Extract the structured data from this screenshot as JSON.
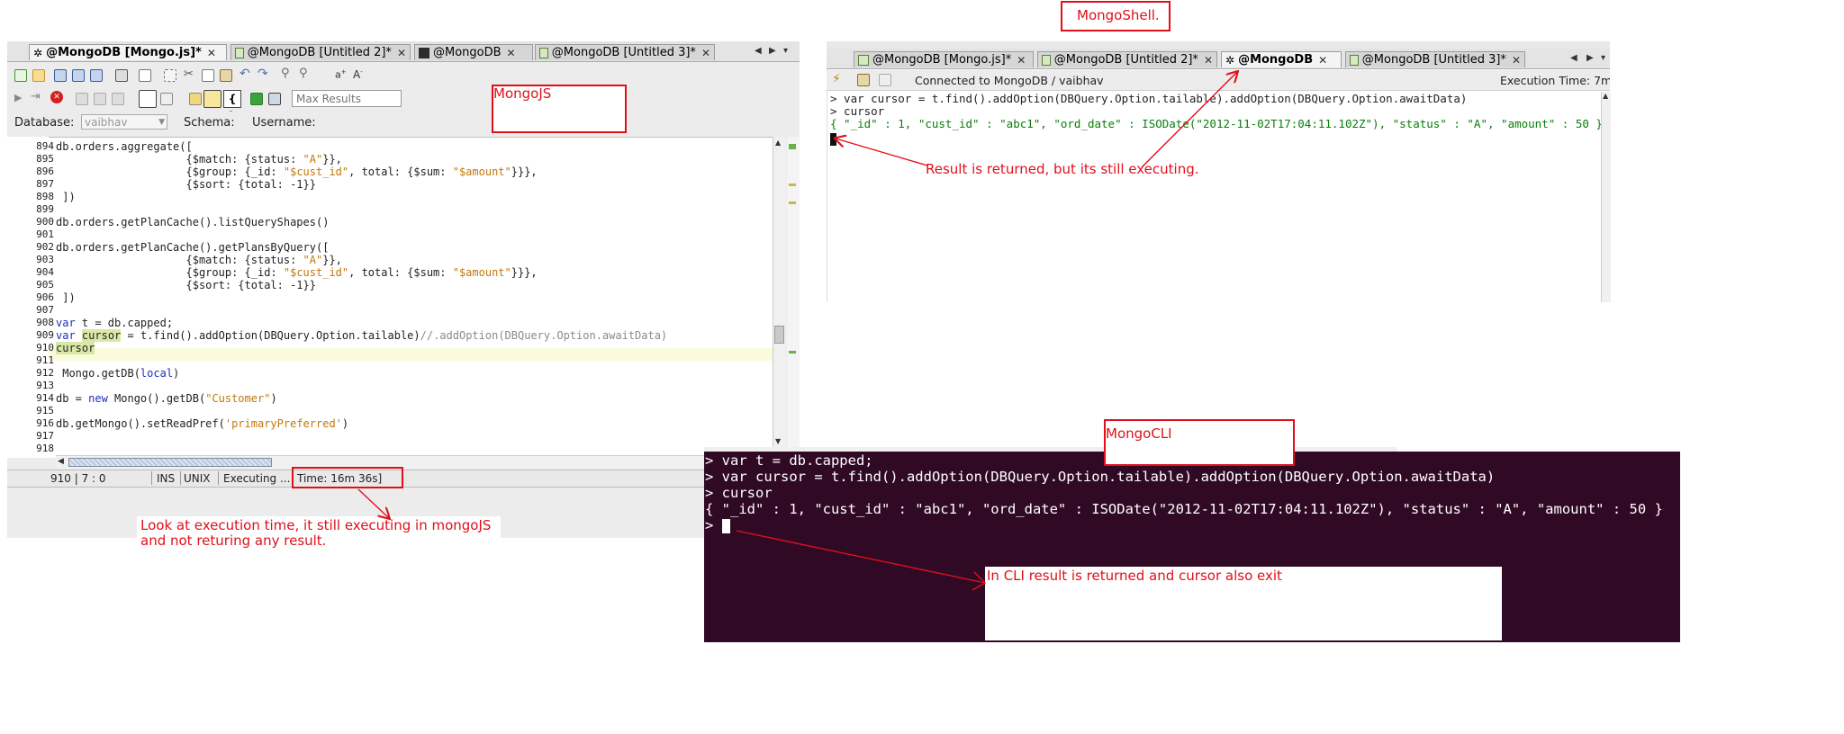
{
  "mongojs": {
    "tabs": [
      {
        "label": "@MongoDB [Mongo.js]*",
        "active": true
      },
      {
        "label": "@MongoDB [Untitled 2]*",
        "active": false
      },
      {
        "label": "@MongoDB",
        "active": false
      },
      {
        "label": "@MongoDB [Untitled 3]*",
        "active": false
      }
    ],
    "max_results_placeholder": "Max Results",
    "database_label": "Database:",
    "database_value": "vaibhav",
    "schema_label": "Schema:",
    "username_label": "Username:",
    "line_numbers": [
      "894",
      "895",
      "896",
      "897",
      "898",
      "899",
      "900",
      "901",
      "902",
      "903",
      "904",
      "905",
      "906",
      "907",
      "908",
      "909",
      "910",
      "911",
      "912",
      "913",
      "914",
      "915",
      "916",
      "917",
      "918"
    ],
    "status": {
      "position": "910 | 7 : 0",
      "mode": "INS",
      "eol": "UNIX",
      "state": "Executing ...",
      "time": "Time: 16m 36s]"
    }
  },
  "mongoshell": {
    "tabs": [
      {
        "label": "@MongoDB [Mongo.js]*",
        "active": false
      },
      {
        "label": "@MongoDB [Untitled 2]*",
        "active": false
      },
      {
        "label": "@MongoDB",
        "active": true
      },
      {
        "label": "@MongoDB [Untitled 3]*",
        "active": false
      }
    ],
    "connected_text": "Connected to MongoDB / vaibhav",
    "exec_time": "Execution Time: 7m",
    "lines": [
      "> var cursor = t.find().addOption(DBQuery.Option.tailable).addOption(DBQuery.Option.awaitData)",
      "> cursor",
      "{ \"_id\" : 1, \"cust_id\" : \"abc1\", \"ord_date\" : ISODate(\"2012-11-02T17:04:11.102Z\"), \"status\" : \"A\", \"amount\" : 50 }"
    ]
  },
  "cli": {
    "lines": [
      "> var t = db.capped;",
      "> var cursor = t.find().addOption(DBQuery.Option.tailable).addOption(DBQuery.Option.awaitData)",
      "> cursor",
      "{ \"_id\" : 1, \"cust_id\" : \"abc1\", \"ord_date\" : ISODate(\"2012-11-02T17:04:11.102Z\"), \"status\" : \"A\", \"amount\" : 50 }",
      "> "
    ]
  },
  "annotations": {
    "mongojs_label": "MongoJS",
    "mongoshell_label": "MongoShell.",
    "mongocli_label": "MongoCLI",
    "shell_note": "Result is returned, but its still executing.",
    "mongojs_note": "Look at execution time, it still executing in mongoJS\nand not returing any result.",
    "cli_note": "In CLI result is returned and cursor also exit"
  },
  "colors": {
    "annotation_red": "#e0101b",
    "terminal_bg": "#300a24",
    "json_green": "#0a7d0a"
  }
}
